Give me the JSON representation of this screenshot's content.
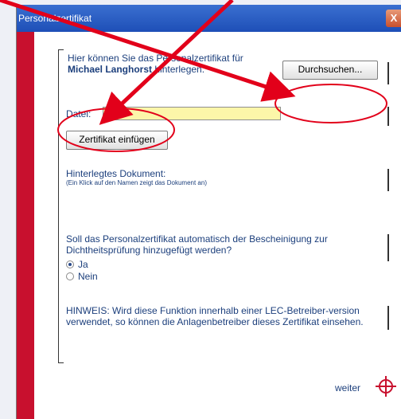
{
  "window": {
    "title": "Personalzertifikat",
    "close_glyph": "X"
  },
  "intro": {
    "line1": "Hier können Sie das Personalzertifikat für",
    "name": "Michael Langhorst",
    "line2_suffix": " hinterlegen."
  },
  "file": {
    "label": "Datei:",
    "value": "",
    "browse_label": "Durchsuchen..."
  },
  "insert_label": "Zertifikat einfügen",
  "document": {
    "heading": "Hinterlegtes Dokument:",
    "note": "(Ein Klick auf den Namen zeigt das Dokument an)"
  },
  "question": "Soll das Personalzertifikat automatisch der Bescheinigung zur Dichtheitsprüfung hinzugefügt werden?",
  "options": [
    {
      "label": "Ja",
      "selected": true
    },
    {
      "label": "Nein",
      "selected": false
    }
  ],
  "hint": "HINWEIS: Wird diese Funktion innerhalb einer LEC-Betreiber-version verwendet, so können die Anlagenbetreiber dieses Zertifikat einsehen.",
  "next_label": "weiter",
  "colors": {
    "accent_red": "#c8102e",
    "title_blue": "#1e4fb7",
    "text_blue": "#1c3f7c",
    "field_yellow": "#fcf6a9"
  },
  "icons": {
    "next": "crosshair-icon",
    "close": "close-icon"
  }
}
